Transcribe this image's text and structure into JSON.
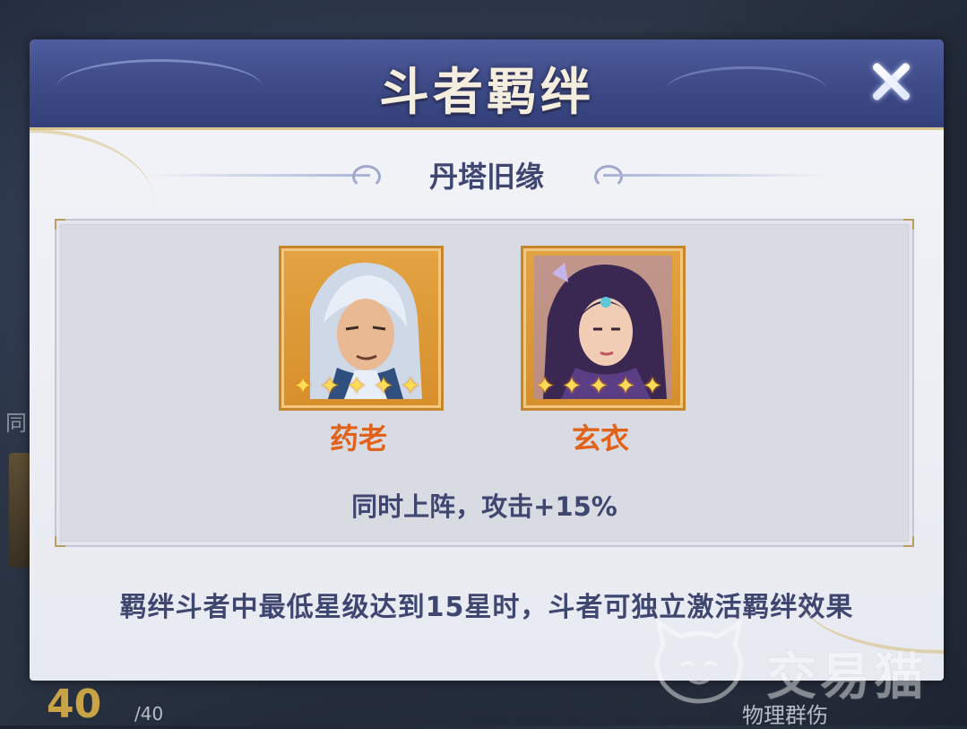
{
  "background": {
    "left_text": "同",
    "level": "40",
    "level_max": "/40",
    "skill_label": "物理群伤"
  },
  "modal": {
    "title": "斗者羁绊",
    "subtitle": "丹塔旧缘",
    "close_icon": "close-icon",
    "heroes": [
      {
        "name": "药老",
        "stars": 5,
        "portrait_icon": "male-warrior-portrait-icon"
      },
      {
        "name": "玄衣",
        "stars": 5,
        "portrait_icon": "female-warrior-portrait-icon"
      }
    ],
    "bond_effect": "同时上阵，攻击+15%",
    "rule": "羁绊斗者中最低星级达到15星时，斗者可独立激活羁绊效果"
  },
  "watermark": {
    "text": "交易猫"
  },
  "colors": {
    "header": "#3e4a86",
    "title_text": "#f5eede",
    "hero_name": "#e1621a",
    "body_text": "#3f4670",
    "card_border": "#c8852c"
  }
}
